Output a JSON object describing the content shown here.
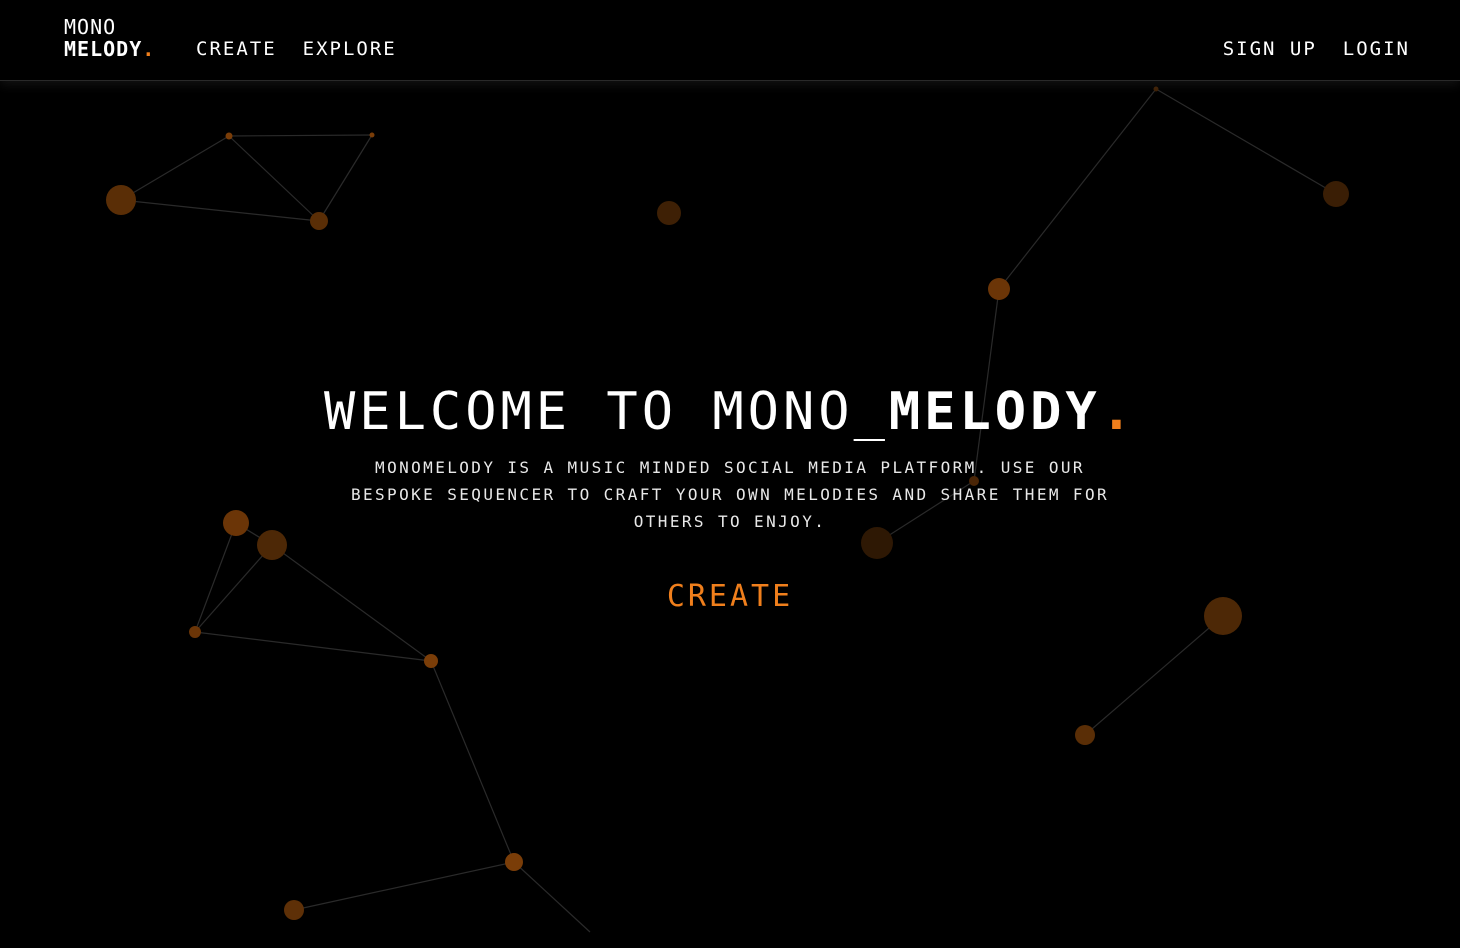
{
  "header": {
    "logo": {
      "line1": "MONO",
      "line2": "MELODY",
      "dot": "."
    },
    "nav_left": [
      {
        "label": "CREATE"
      },
      {
        "label": "EXPLORE"
      }
    ],
    "nav_right": [
      {
        "label": "SIGN UP"
      },
      {
        "label": "LOGIN"
      }
    ]
  },
  "hero": {
    "title_prefix": "WELCOME TO MONO_",
    "title_bold": "MELODY",
    "title_dot": ".",
    "description": "MONOMELODY IS A MUSIC MINDED SOCIAL MEDIA PLATFORM. USE OUR BESPOKE SEQUENCER TO CRAFT YOUR OWN MELODIES AND SHARE THEM FOR OTHERS TO ENJOY.",
    "cta_label": "CREATE"
  },
  "colors": {
    "background": "#000000",
    "accent": "#f07f1c",
    "node": "#5a2e06",
    "link": "#2b2b2b"
  }
}
